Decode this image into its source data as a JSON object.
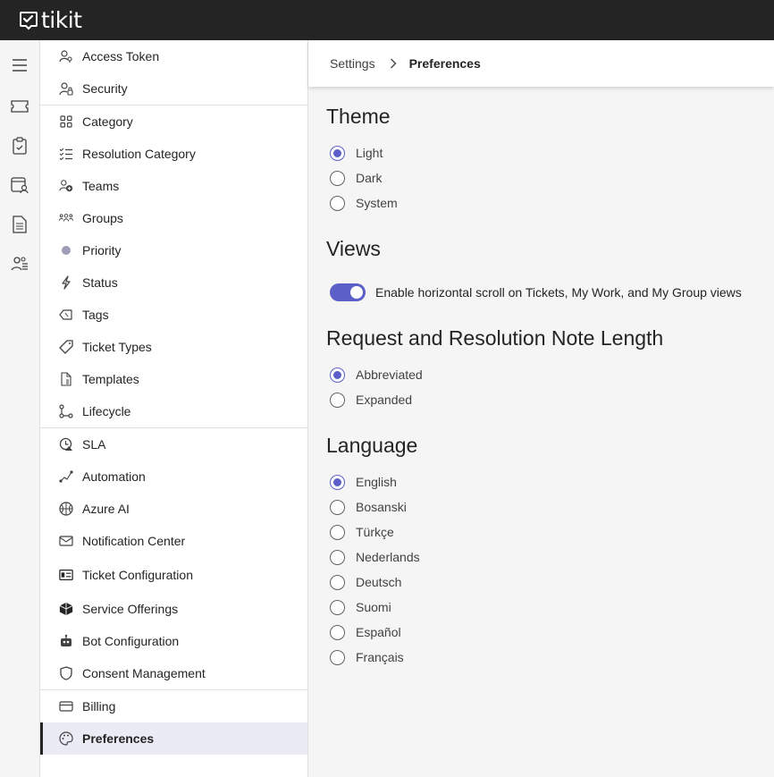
{
  "app": {
    "logo_text": "tikit"
  },
  "sidenav": {
    "items": [
      {
        "label": "Access Token",
        "icon": "key-person-icon"
      },
      {
        "label": "Security",
        "icon": "person-lock-icon"
      },
      {
        "label": "Category",
        "icon": "grid-icon"
      },
      {
        "label": "Resolution Category",
        "icon": "checklist-icon"
      },
      {
        "label": "Teams",
        "icon": "team-add-icon"
      },
      {
        "label": "Groups",
        "icon": "people-group-icon"
      },
      {
        "label": "Priority",
        "icon": "dot-icon"
      },
      {
        "label": "Status",
        "icon": "flash-icon"
      },
      {
        "label": "Tags",
        "icon": "tag-icon"
      },
      {
        "label": "Ticket Types",
        "icon": "tag-outline-icon"
      },
      {
        "label": "Templates",
        "icon": "document-icon"
      },
      {
        "label": "Lifecycle",
        "icon": "branch-icon"
      },
      {
        "label": "SLA",
        "icon": "clock-alert-icon"
      },
      {
        "label": "Automation",
        "icon": "flow-icon"
      },
      {
        "label": "Azure AI",
        "icon": "brain-icon"
      },
      {
        "label": "Notification Center",
        "icon": "mail-icon"
      },
      {
        "label": "Ticket Configuration",
        "icon": "ticket-config-icon"
      },
      {
        "label": "Service Offerings",
        "icon": "box-icon"
      },
      {
        "label": "Bot Configuration",
        "icon": "bot-icon"
      },
      {
        "label": "Consent Management",
        "icon": "shield-icon"
      },
      {
        "label": "Billing",
        "icon": "card-icon"
      },
      {
        "label": "Preferences",
        "icon": "palette-icon",
        "active": true
      }
    ]
  },
  "breadcrumb": {
    "root": "Settings",
    "current": "Preferences"
  },
  "theme": {
    "title": "Theme",
    "options": [
      "Light",
      "Dark",
      "System"
    ],
    "selected": "Light"
  },
  "views": {
    "title": "Views",
    "toggle_label": "Enable horizontal scroll on Tickets, My Work, and My Group views",
    "toggle_on": true
  },
  "note_length": {
    "title": "Request and Resolution Note Length",
    "options": [
      "Abbreviated",
      "Expanded"
    ],
    "selected": "Abbreviated"
  },
  "language": {
    "title": "Language",
    "options": [
      "English",
      "Bosanski",
      "Türkçe",
      "Nederlands",
      "Deutsch",
      "Suomi",
      "Español",
      "Français"
    ],
    "selected": "English"
  },
  "colors": {
    "accent": "#5b5fc7",
    "topbar": "#242424",
    "active_bg": "#ebebf5"
  }
}
